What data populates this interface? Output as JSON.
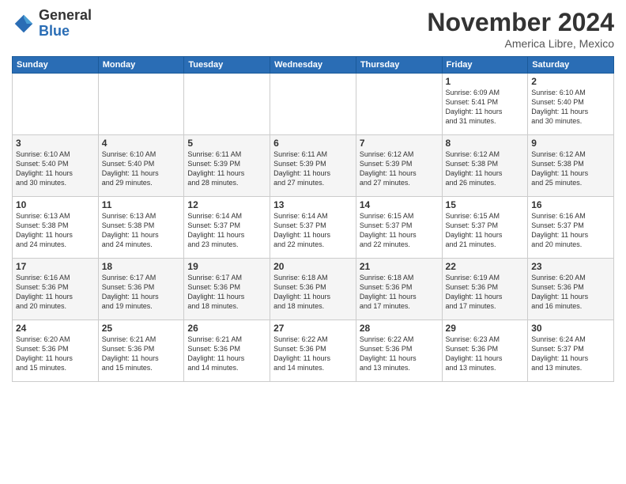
{
  "logo": {
    "general": "General",
    "blue": "Blue"
  },
  "title": "November 2024",
  "location": "America Libre, Mexico",
  "days_of_week": [
    "Sunday",
    "Monday",
    "Tuesday",
    "Wednesday",
    "Thursday",
    "Friday",
    "Saturday"
  ],
  "weeks": [
    [
      {
        "day": "",
        "info": ""
      },
      {
        "day": "",
        "info": ""
      },
      {
        "day": "",
        "info": ""
      },
      {
        "day": "",
        "info": ""
      },
      {
        "day": "",
        "info": ""
      },
      {
        "day": "1",
        "info": "Sunrise: 6:09 AM\nSunset: 5:41 PM\nDaylight: 11 hours\nand 31 minutes."
      },
      {
        "day": "2",
        "info": "Sunrise: 6:10 AM\nSunset: 5:40 PM\nDaylight: 11 hours\nand 30 minutes."
      }
    ],
    [
      {
        "day": "3",
        "info": "Sunrise: 6:10 AM\nSunset: 5:40 PM\nDaylight: 11 hours\nand 30 minutes."
      },
      {
        "day": "4",
        "info": "Sunrise: 6:10 AM\nSunset: 5:40 PM\nDaylight: 11 hours\nand 29 minutes."
      },
      {
        "day": "5",
        "info": "Sunrise: 6:11 AM\nSunset: 5:39 PM\nDaylight: 11 hours\nand 28 minutes."
      },
      {
        "day": "6",
        "info": "Sunrise: 6:11 AM\nSunset: 5:39 PM\nDaylight: 11 hours\nand 27 minutes."
      },
      {
        "day": "7",
        "info": "Sunrise: 6:12 AM\nSunset: 5:39 PM\nDaylight: 11 hours\nand 27 minutes."
      },
      {
        "day": "8",
        "info": "Sunrise: 6:12 AM\nSunset: 5:38 PM\nDaylight: 11 hours\nand 26 minutes."
      },
      {
        "day": "9",
        "info": "Sunrise: 6:12 AM\nSunset: 5:38 PM\nDaylight: 11 hours\nand 25 minutes."
      }
    ],
    [
      {
        "day": "10",
        "info": "Sunrise: 6:13 AM\nSunset: 5:38 PM\nDaylight: 11 hours\nand 24 minutes."
      },
      {
        "day": "11",
        "info": "Sunrise: 6:13 AM\nSunset: 5:38 PM\nDaylight: 11 hours\nand 24 minutes."
      },
      {
        "day": "12",
        "info": "Sunrise: 6:14 AM\nSunset: 5:37 PM\nDaylight: 11 hours\nand 23 minutes."
      },
      {
        "day": "13",
        "info": "Sunrise: 6:14 AM\nSunset: 5:37 PM\nDaylight: 11 hours\nand 22 minutes."
      },
      {
        "day": "14",
        "info": "Sunrise: 6:15 AM\nSunset: 5:37 PM\nDaylight: 11 hours\nand 22 minutes."
      },
      {
        "day": "15",
        "info": "Sunrise: 6:15 AM\nSunset: 5:37 PM\nDaylight: 11 hours\nand 21 minutes."
      },
      {
        "day": "16",
        "info": "Sunrise: 6:16 AM\nSunset: 5:37 PM\nDaylight: 11 hours\nand 20 minutes."
      }
    ],
    [
      {
        "day": "17",
        "info": "Sunrise: 6:16 AM\nSunset: 5:36 PM\nDaylight: 11 hours\nand 20 minutes."
      },
      {
        "day": "18",
        "info": "Sunrise: 6:17 AM\nSunset: 5:36 PM\nDaylight: 11 hours\nand 19 minutes."
      },
      {
        "day": "19",
        "info": "Sunrise: 6:17 AM\nSunset: 5:36 PM\nDaylight: 11 hours\nand 18 minutes."
      },
      {
        "day": "20",
        "info": "Sunrise: 6:18 AM\nSunset: 5:36 PM\nDaylight: 11 hours\nand 18 minutes."
      },
      {
        "day": "21",
        "info": "Sunrise: 6:18 AM\nSunset: 5:36 PM\nDaylight: 11 hours\nand 17 minutes."
      },
      {
        "day": "22",
        "info": "Sunrise: 6:19 AM\nSunset: 5:36 PM\nDaylight: 11 hours\nand 17 minutes."
      },
      {
        "day": "23",
        "info": "Sunrise: 6:20 AM\nSunset: 5:36 PM\nDaylight: 11 hours\nand 16 minutes."
      }
    ],
    [
      {
        "day": "24",
        "info": "Sunrise: 6:20 AM\nSunset: 5:36 PM\nDaylight: 11 hours\nand 15 minutes."
      },
      {
        "day": "25",
        "info": "Sunrise: 6:21 AM\nSunset: 5:36 PM\nDaylight: 11 hours\nand 15 minutes."
      },
      {
        "day": "26",
        "info": "Sunrise: 6:21 AM\nSunset: 5:36 PM\nDaylight: 11 hours\nand 14 minutes."
      },
      {
        "day": "27",
        "info": "Sunrise: 6:22 AM\nSunset: 5:36 PM\nDaylight: 11 hours\nand 14 minutes."
      },
      {
        "day": "28",
        "info": "Sunrise: 6:22 AM\nSunset: 5:36 PM\nDaylight: 11 hours\nand 13 minutes."
      },
      {
        "day": "29",
        "info": "Sunrise: 6:23 AM\nSunset: 5:36 PM\nDaylight: 11 hours\nand 13 minutes."
      },
      {
        "day": "30",
        "info": "Sunrise: 6:24 AM\nSunset: 5:37 PM\nDaylight: 11 hours\nand 13 minutes."
      }
    ]
  ]
}
